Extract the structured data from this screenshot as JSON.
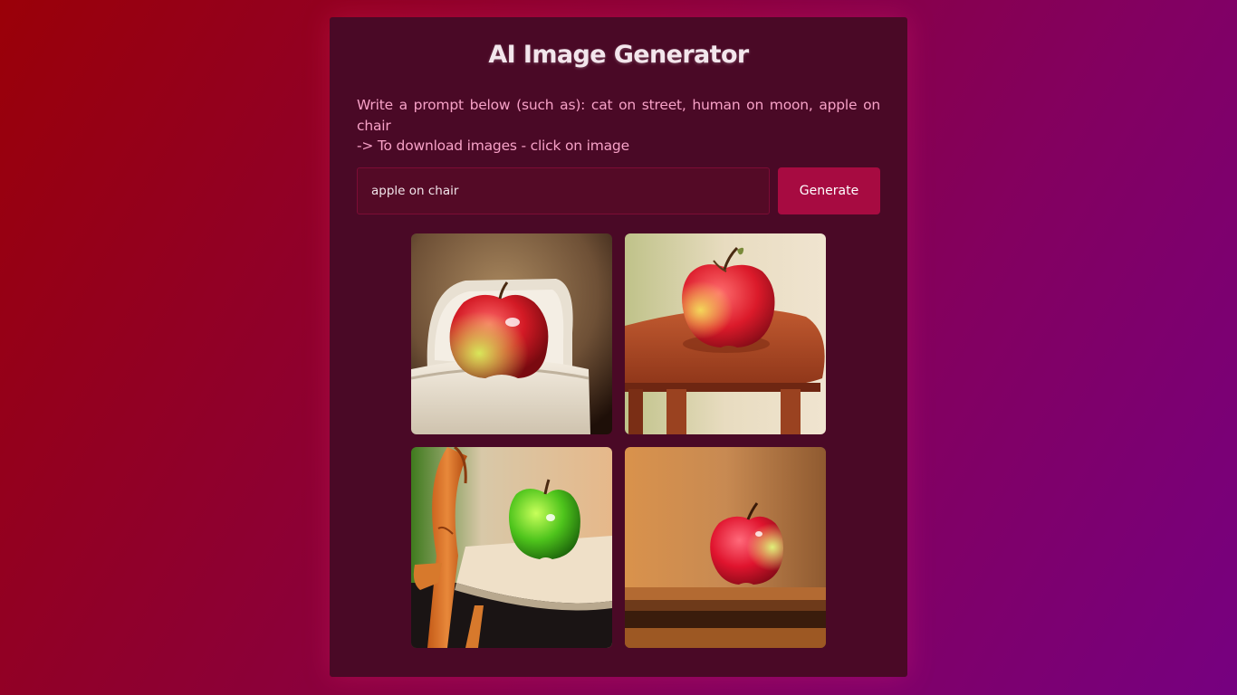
{
  "app": {
    "title": "AI Image Generator",
    "description_line1": "Write a prompt below (such as): cat on street, human on moon, apple on chair",
    "description_line2": "-> To download images - click on image"
  },
  "form": {
    "prompt_value": "apple on chair",
    "generate_label": "Generate"
  },
  "images": [
    {
      "icon": "apple-on-white-chair-image"
    },
    {
      "icon": "apple-on-wooden-table-image"
    },
    {
      "icon": "green-apple-on-chair-image"
    },
    {
      "icon": "apple-on-shelf-image"
    }
  ],
  "colors": {
    "background_start": "#9a0008",
    "background_end": "#760080",
    "card": "#4a0926",
    "accent": "#a70b41",
    "description_text": "#f7a1c7"
  }
}
